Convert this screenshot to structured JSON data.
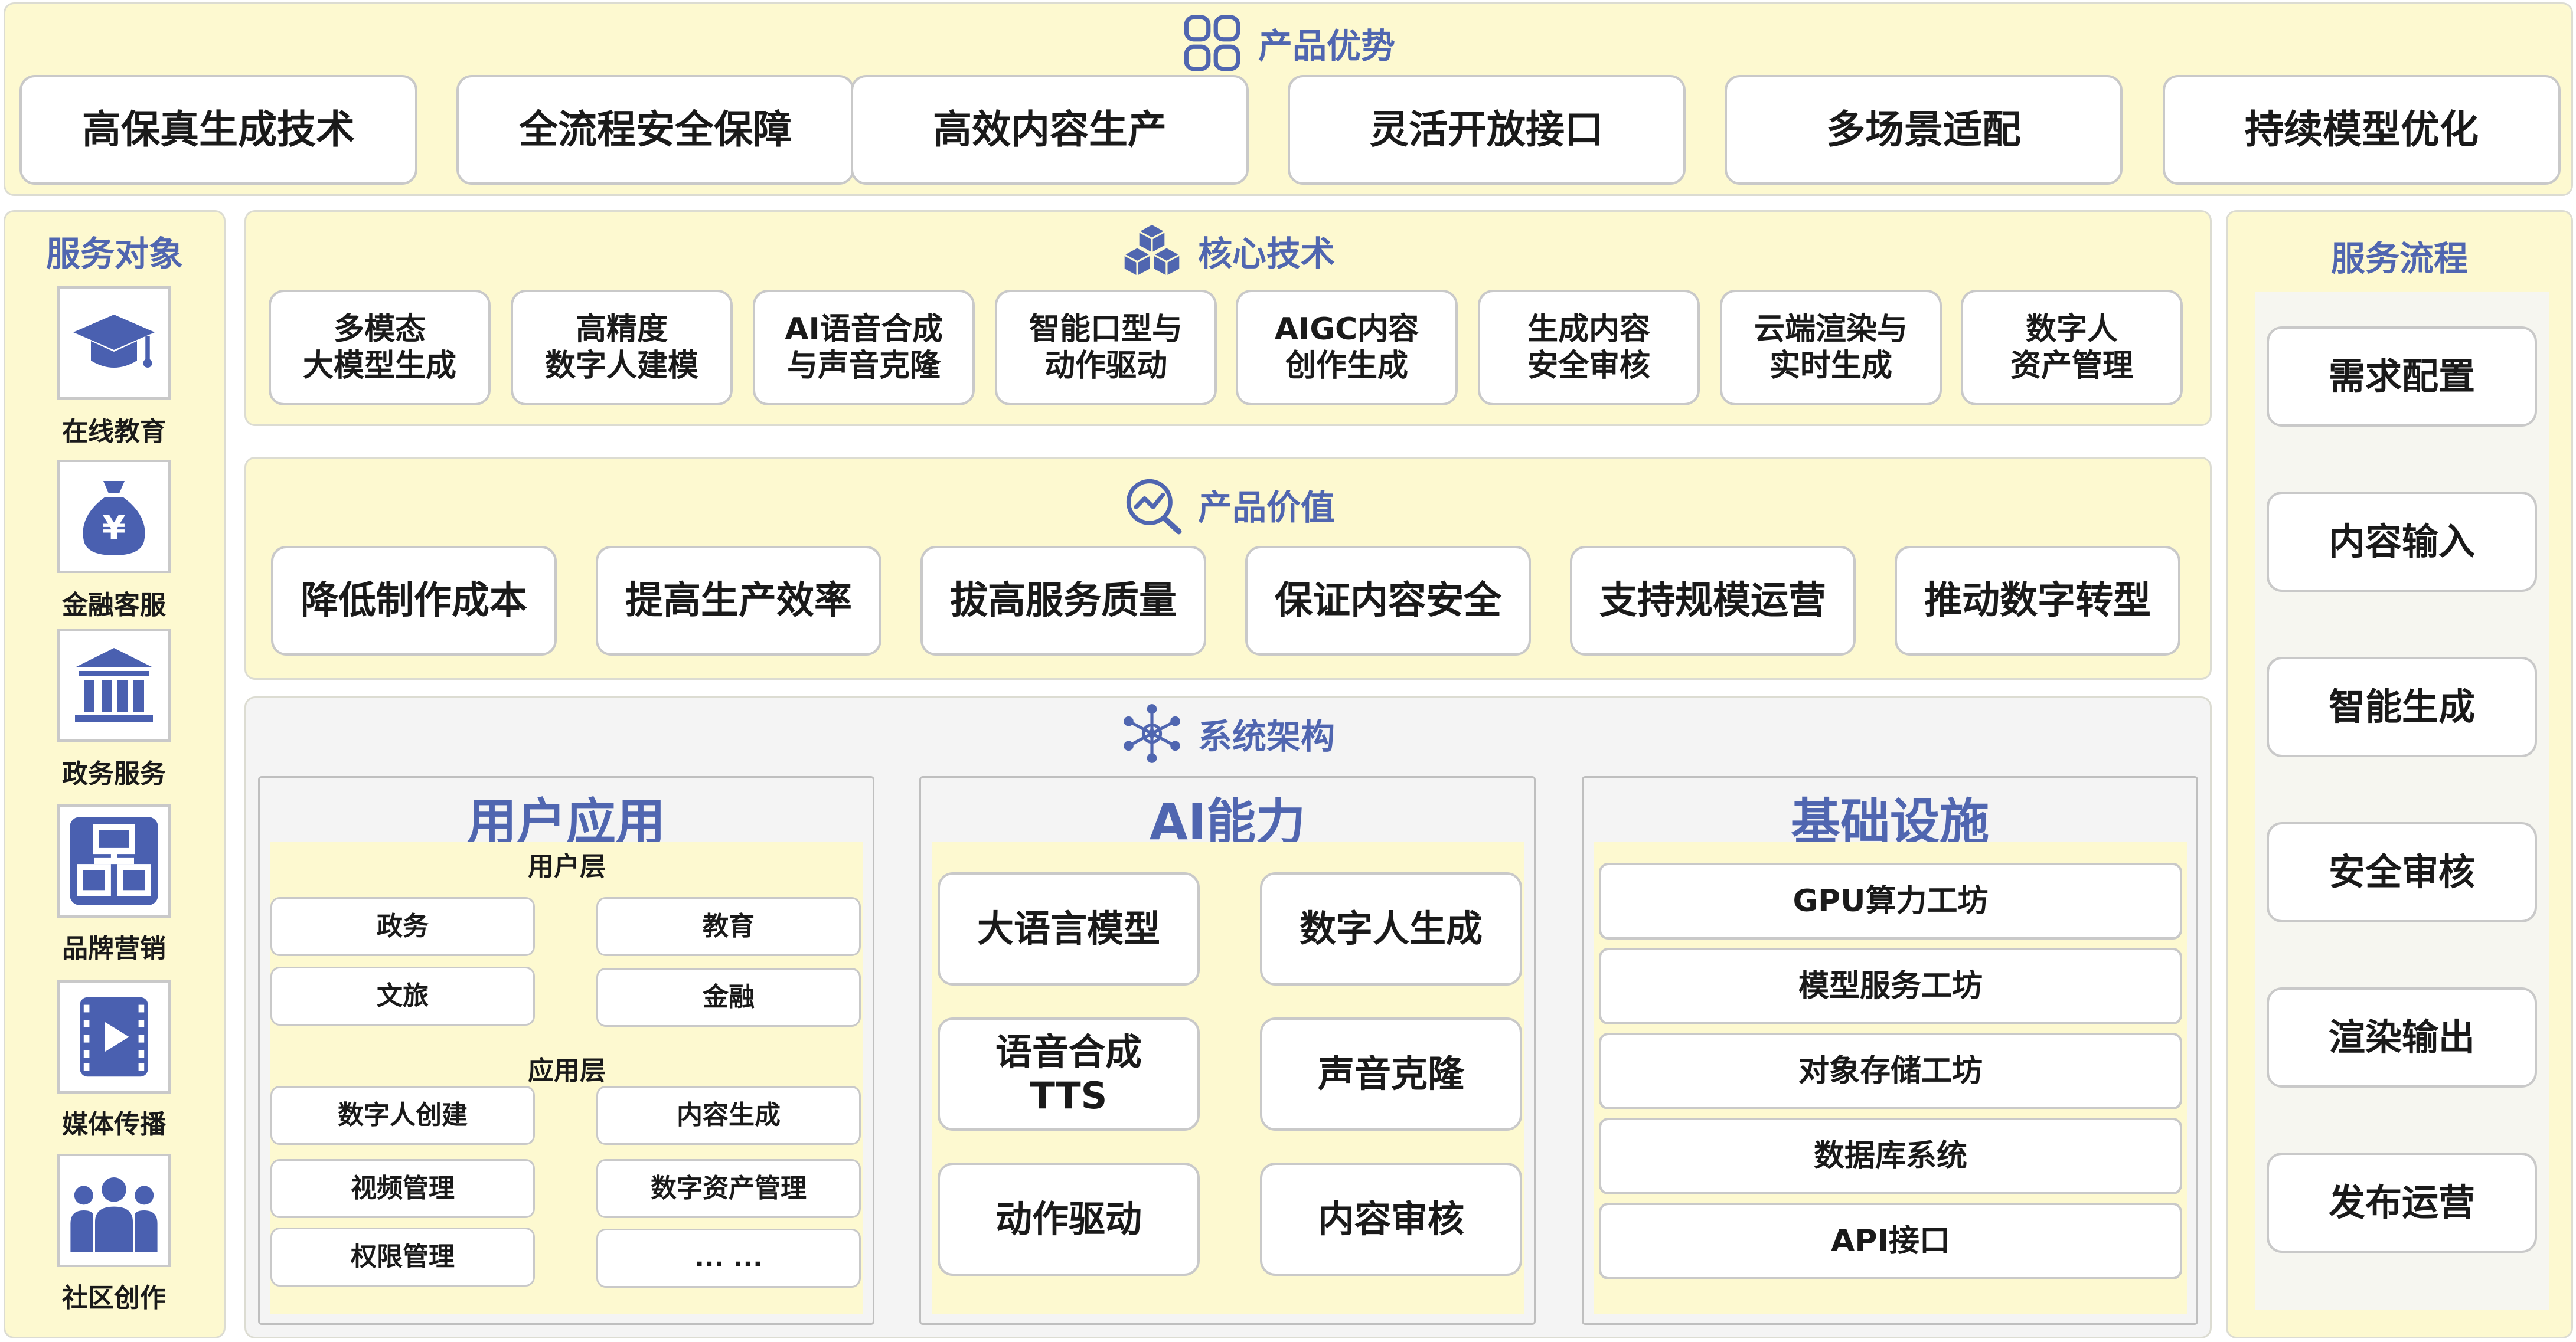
{
  "advantages": {
    "title": "产品优势",
    "icon": "grid-icon",
    "items": [
      "高保真生成技术",
      "全流程安全保障",
      "高效内容生产",
      "灵活开放接口",
      "多场景适配",
      "持续模型优化"
    ]
  },
  "core_tech": {
    "title": "核心技术",
    "icon": "cubes-icon",
    "items": [
      {
        "line1": "多模态",
        "line2": "大模型生成"
      },
      {
        "line1": "高精度",
        "line2": "数字人建模"
      },
      {
        "line1": "AI语音合成",
        "line2": "与声音克隆"
      },
      {
        "line1": "智能口型与",
        "line2": "动作驱动"
      },
      {
        "line1": "AIGC内容",
        "line2": "创作生成"
      },
      {
        "line1": "生成内容",
        "line2": "安全审核"
      },
      {
        "line1": "云端渲染与",
        "line2": "实时生成"
      },
      {
        "line1": "数字人",
        "line2": "资产管理"
      }
    ]
  },
  "value": {
    "title": "产品价值",
    "icon": "chart-magnifier-icon",
    "items": [
      "降低制作成本",
      "提高生产效率",
      "拔高服务质量",
      "保证内容安全",
      "支持规模运营",
      "推动数字转型"
    ]
  },
  "architecture": {
    "title": "系统架构",
    "icon": "network-icon",
    "user_app": {
      "title": "用户应用",
      "user_layer": {
        "title": "用户层",
        "items": [
          "政务",
          "教育",
          "文旅",
          "金融"
        ]
      },
      "app_layer": {
        "title": "应用层",
        "items": [
          "数字人创建",
          "内容生成",
          "视频管理",
          "数字资产管理",
          "权限管理",
          "... ..."
        ]
      }
    },
    "ai": {
      "title": "AI能力",
      "items": [
        {
          "line1": "大语言模型",
          "line2": ""
        },
        {
          "line1": "数字人生成",
          "line2": ""
        },
        {
          "line1": "语音合成",
          "line2": "TTS"
        },
        {
          "line1": "声音克隆",
          "line2": ""
        },
        {
          "line1": "动作驱动",
          "line2": ""
        },
        {
          "line1": "内容审核",
          "line2": ""
        }
      ]
    },
    "infra": {
      "title": "基础设施",
      "items": [
        "GPU算力工坊",
        "模型服务工坊",
        "对象存储工坊",
        "数据库系统",
        "API接口"
      ]
    }
  },
  "service_targets": {
    "title": "服务对象",
    "items": [
      {
        "label": "在线教育",
        "icon": "graduation-cap-icon"
      },
      {
        "label": "金融客服",
        "icon": "money-bag-icon"
      },
      {
        "label": "政务服务",
        "icon": "government-building-icon"
      },
      {
        "label": "品牌营销",
        "icon": "brand-blocks-icon"
      },
      {
        "label": "媒体传播",
        "icon": "video-play-icon"
      },
      {
        "label": "社区创作",
        "icon": "people-group-icon"
      }
    ]
  },
  "service_flow": {
    "title": "服务流程",
    "items": [
      "需求配置",
      "内容输入",
      "智能生成",
      "安全审核",
      "渲染输出",
      "发布运营"
    ]
  },
  "colors": {
    "accent": "#5066b0",
    "panel_bg": "#fdf9d0",
    "border": "#c9c9c9"
  }
}
